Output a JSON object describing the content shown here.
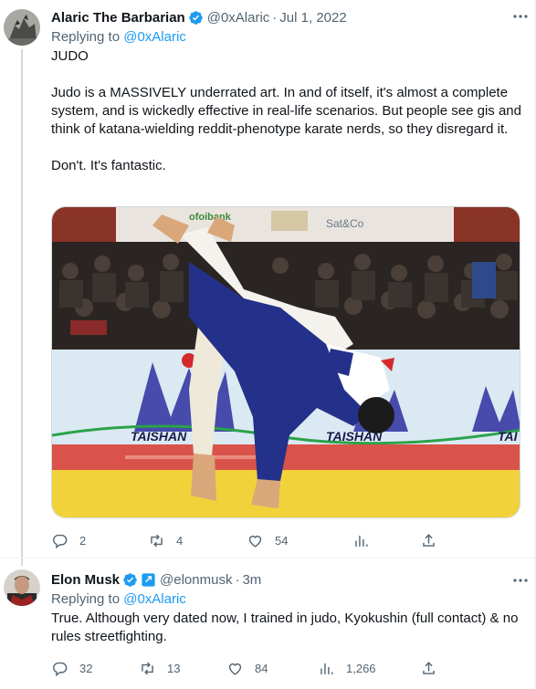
{
  "tweets": [
    {
      "display_name": "Alaric The Barbarian",
      "handle": "@0xAlaric",
      "separator": "·",
      "timestamp": "Jul 1, 2022",
      "replying_prefix": "Replying to",
      "replying_to": "@0xAlaric",
      "paragraphs": [
        "JUDO",
        "Judo is a MASSIVELY underrated art. In and of itself, it's almost a complete system, and is wickedly effective in real-life scenarios. But people see gis and think of katana-wielding reddit-phenotype karate nerds, so they disregard it.",
        "Don't. It's fantastic."
      ],
      "media": {
        "banner_left": "ofoibank",
        "banner_right": "Sat&Co",
        "board_text_1": "TAISHAN",
        "board_text_2": "TAISHAN",
        "board_text_3": "TAI"
      },
      "stats": {
        "replies": "2",
        "retweets": "4",
        "likes": "54",
        "views": ""
      }
    },
    {
      "display_name": "Elon Musk",
      "handle": "@elonmusk",
      "separator": "·",
      "timestamp": "3m",
      "replying_prefix": "Replying to",
      "replying_to": "@0xAlaric",
      "paragraphs": [
        "True. Although very dated now, I trained in judo, Kyokushin (full contact) & no rules streetfighting."
      ],
      "stats": {
        "replies": "32",
        "retweets": "13",
        "likes": "84",
        "views": "1,266"
      }
    }
  ],
  "colors": {
    "verified_blue": "#1d9bf0",
    "secondary_text": "#536471",
    "primary_text": "#0f1419",
    "thread_line": "#cfd9de"
  },
  "icons": [
    "verified-badge-icon",
    "more-icon",
    "reply-icon",
    "retweet-icon",
    "like-icon",
    "views-icon",
    "share-icon",
    "government-badge-icon"
  ]
}
